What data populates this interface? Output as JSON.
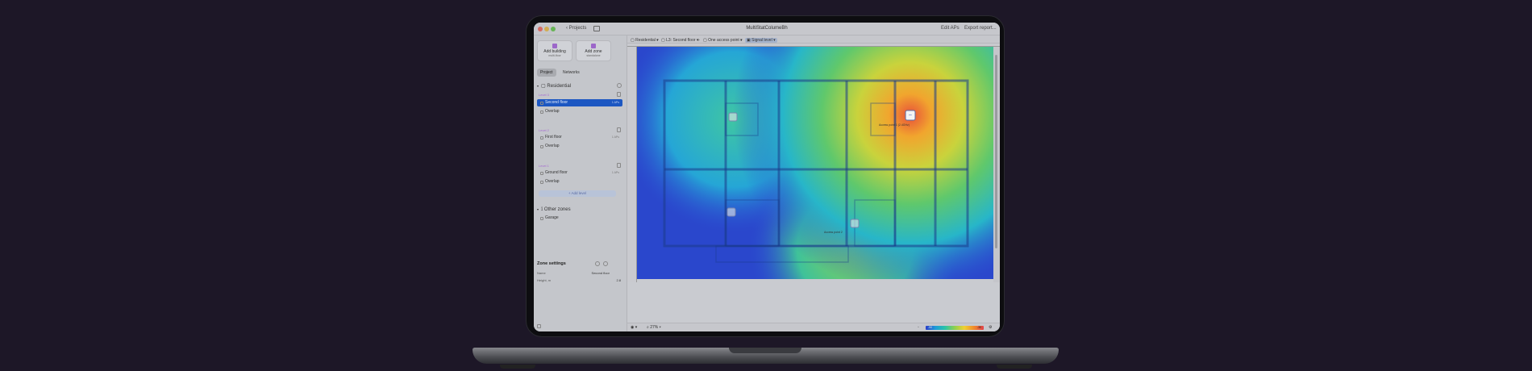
{
  "window": {
    "back_label": "Projects",
    "title": "MultiStatColumeBh",
    "edit_aps": "Edit APs",
    "export": "Export report..."
  },
  "sidebar": {
    "add_building": {
      "label": "Add building",
      "sub": "multi-floor"
    },
    "add_zone": {
      "label": "Add zone",
      "sub": "standalone"
    },
    "tabs": [
      "Project",
      "Networks"
    ],
    "building": "Residential",
    "levels": [
      {
        "name": "Level 3",
        "floor": "Second floor",
        "floor_meta": "1 APs",
        "overlap": "Overlap"
      },
      {
        "name": "Level 2",
        "floor": "First floor",
        "floor_meta": "1 APs",
        "overlap": "Overlap"
      },
      {
        "name": "Level 1",
        "floor": "Ground floor",
        "floor_meta": "1 APs",
        "overlap": "Overlap"
      }
    ],
    "add_level": "+ Add level",
    "other_zones": "Other zones",
    "garage": "Garage",
    "zone_settings": {
      "title": "Zone settings",
      "name_label": "Name",
      "name_value": "Second floor",
      "height_label": "Height, m",
      "height_value": "2.8"
    }
  },
  "breadcrumbs": [
    "Residential",
    "L3: Second floor",
    "One access point",
    "Signal level"
  ],
  "ap_labels": [
    "Access point 1 (2.4GHz)",
    "Access point 2"
  ],
  "statusbar": {
    "zoom": "27%",
    "legend_low": "-90",
    "legend_high": "-30"
  },
  "colors": {
    "accent": "#1c57c2",
    "level_label": "#a56ad0",
    "heat_low": "#2a3cc8",
    "heat_high": "#e0404a"
  }
}
